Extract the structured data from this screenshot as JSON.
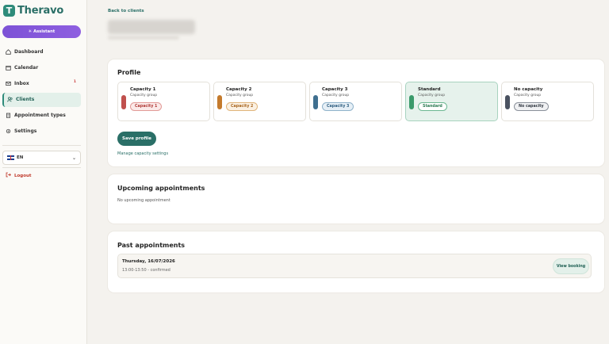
{
  "app": {
    "name": "Theravo",
    "logo_letter": "T"
  },
  "sidebar": {
    "assistant_label": "Assistant",
    "items": [
      {
        "label": "Dashboard",
        "icon": "home-icon"
      },
      {
        "label": "Calendar",
        "icon": "calendar-icon"
      },
      {
        "label": "Inbox",
        "icon": "inbox-icon",
        "badge": "1"
      },
      {
        "label": "Clients",
        "icon": "users-icon",
        "active": true
      },
      {
        "label": "Appointment types",
        "icon": "clipboard-icon"
      },
      {
        "label": "Settings",
        "icon": "gear-icon"
      }
    ],
    "language": "EN",
    "logout_label": "Logout"
  },
  "header": {
    "back_link": "Back to clients"
  },
  "profile": {
    "title": "Profile",
    "capacities": [
      {
        "title": "Capacity 1",
        "subtitle": "Capacity group",
        "pill": "Capacity 1",
        "color": "#c0504d",
        "pill_bg": "#fbe9e8",
        "pill_border": "#e29a97",
        "pill_text": "#b03a37"
      },
      {
        "title": "Capacity 2",
        "subtitle": "Capacity group",
        "pill": "Capacity 2",
        "color": "#c47a2c",
        "pill_bg": "#fbf1e3",
        "pill_border": "#e0b47a",
        "pill_text": "#a8651f"
      },
      {
        "title": "Capacity 3",
        "subtitle": "Capacity group",
        "pill": "Capacity 3",
        "color": "#3f6f8f",
        "pill_bg": "#e6eff6",
        "pill_border": "#8fb2ca",
        "pill_text": "#2f5e80"
      },
      {
        "title": "Standard",
        "subtitle": "Capacity group",
        "pill": "Standard",
        "color": "#3a9a6a",
        "pill_bg": "#ffffff",
        "pill_border": "#6cb892",
        "pill_text": "#2b7a52",
        "selected": true
      },
      {
        "title": "No capacity",
        "subtitle": "Capacity group",
        "pill": "No capacity",
        "color": "#4a5260",
        "pill_bg": "#f0f1f3",
        "pill_border": "#8a909a",
        "pill_text": "#333a44"
      }
    ],
    "save_label": "Save profile",
    "manage_link": "Manage capacity settings"
  },
  "upcoming": {
    "title": "Upcoming appointments",
    "empty_text": "No upcoming appointment"
  },
  "past": {
    "title": "Past appointments",
    "appointments": [
      {
        "date": "Thursday, 16/07/2026",
        "meta": "13:00-13:50 - confirmed",
        "action": "View booking"
      }
    ]
  }
}
